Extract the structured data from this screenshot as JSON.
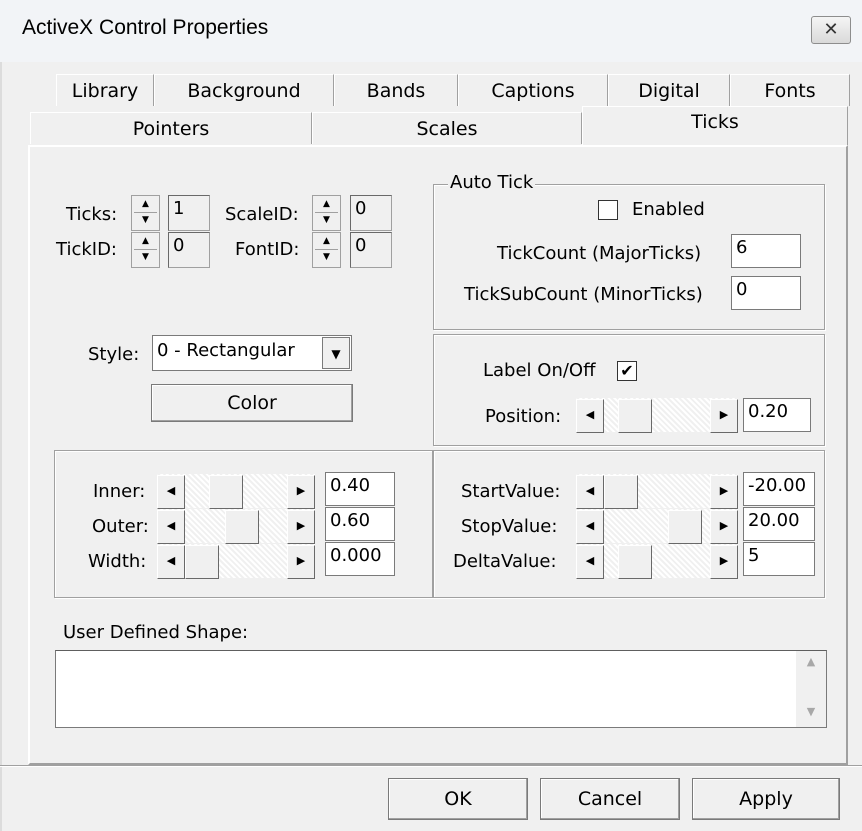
{
  "window": {
    "title": "ActiveX Control Properties",
    "close_glyph": "✕"
  },
  "tabs_row1": [
    "Library",
    "Background",
    "Bands",
    "Captions",
    "Digital",
    "Fonts"
  ],
  "tabs_row2": [
    "Pointers",
    "Scales",
    "Ticks"
  ],
  "active_tab": "Ticks",
  "indices": {
    "ticks_label": "Ticks:",
    "ticks_value": "1",
    "scaleid_label": "ScaleID:",
    "scaleid_value": "0",
    "tickid_label": "TickID:",
    "tickid_value": "0",
    "fontid_label": "FontID:",
    "fontid_value": "0"
  },
  "auto_tick": {
    "group_label": "Auto Tick",
    "enabled_label": "Enabled",
    "enabled": false,
    "tickcount_label": "TickCount (MajorTicks)",
    "tickcount_value": "6",
    "ticksubcount_label": "TickSubCount (MinorTicks)",
    "ticksubcount_value": "0"
  },
  "style": {
    "label": "Style:",
    "value": "0 - Rectangular",
    "color_button": "Color"
  },
  "label_group": {
    "label_onoff": "Label On/Off",
    "label_checked": true,
    "check_glyph": "✔",
    "position_label": "Position:",
    "position_value": "0.20"
  },
  "geometry": {
    "inner_label": "Inner:",
    "inner_value": "0.40",
    "outer_label": "Outer:",
    "outer_value": "0.60",
    "width_label": "Width:",
    "width_value": "0.000"
  },
  "range": {
    "start_label": "StartValue:",
    "start_value": "-20.00",
    "stop_label": "StopValue:",
    "stop_value": "20.00",
    "delta_label": "DeltaValue:",
    "delta_value": "5"
  },
  "user_defined_shape": {
    "label": "User Defined Shape:",
    "value": ""
  },
  "buttons": {
    "ok": "OK",
    "cancel": "Cancel",
    "apply": "Apply"
  },
  "icons": {
    "spin_up": "▲",
    "spin_down": "▼",
    "left": "◀",
    "right": "▶",
    "dropdown": "▼",
    "scroll_up": "▲",
    "scroll_down": "▼"
  }
}
